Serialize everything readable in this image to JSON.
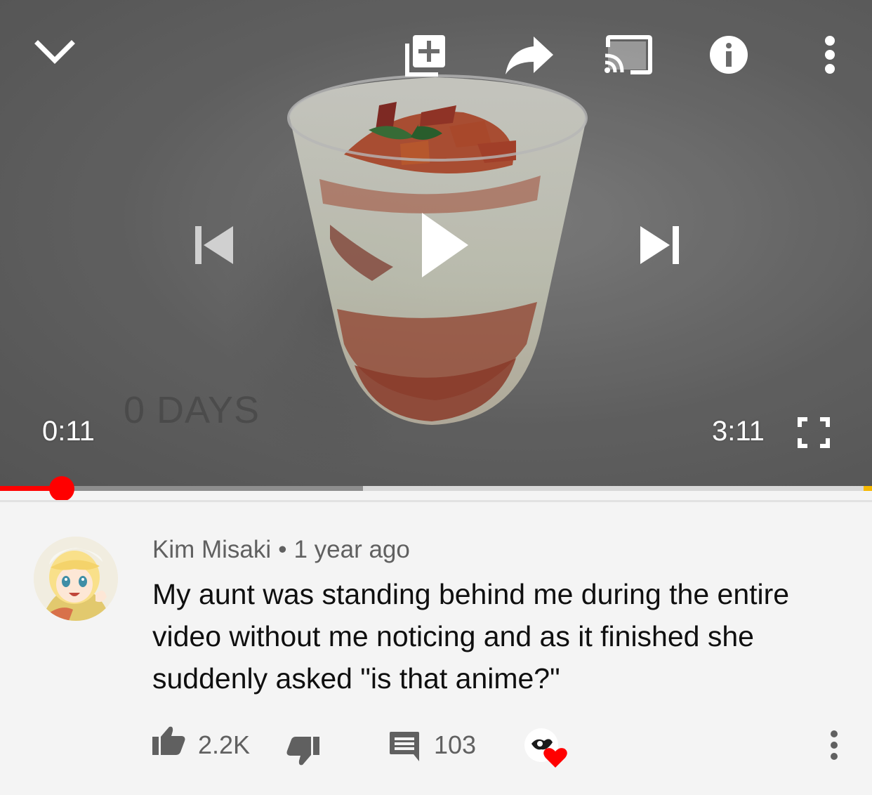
{
  "player": {
    "current_time": "0:11",
    "duration": "3:11",
    "watermark_text": "0 DAYS",
    "progress": {
      "played_fraction": 0.071,
      "buffered_fraction": 0.416
    }
  },
  "top_controls": [
    {
      "name": "collapse",
      "icon": "chevron-down-icon"
    },
    {
      "name": "add-to-playlist",
      "icon": "add-to-playlist-icon"
    },
    {
      "name": "share",
      "icon": "share-icon"
    },
    {
      "name": "cast",
      "icon": "cast-icon"
    },
    {
      "name": "info",
      "icon": "info-icon"
    },
    {
      "name": "more",
      "icon": "more-vertical-icon"
    }
  ],
  "comment": {
    "author": "Kim Misaki",
    "separator": "•",
    "age": "1 year ago",
    "text": "My aunt was standing behind me during the entire video without me noticing and as it finished she suddenly asked \"is that anime?\"",
    "likes": "2.2K",
    "replies": "103",
    "creator_heart": true
  },
  "colors": {
    "accent": "#ff0000",
    "text_primary": "#0f0f0f",
    "text_secondary": "#606060",
    "background": "#f4f4f4",
    "ad_marker": "#f6b800"
  }
}
